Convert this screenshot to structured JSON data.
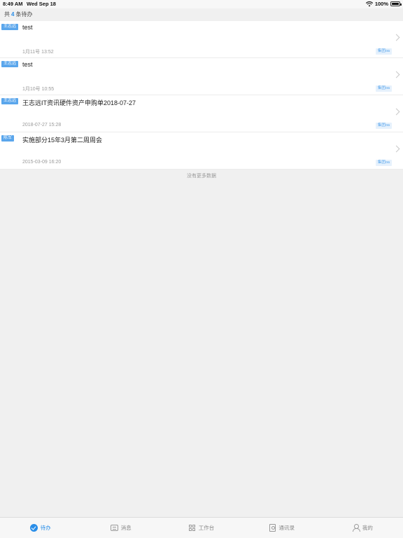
{
  "status_bar": {
    "time": "8:49 AM",
    "date": "Wed Sep 18",
    "battery": "100%",
    "icons": [
      "wifi-icon",
      "battery-icon"
    ]
  },
  "summary": {
    "prefix": "共",
    "count": "4",
    "suffix": "条待办"
  },
  "items": [
    {
      "tag": "王志远",
      "title": "test",
      "time": "1月11号 13:52",
      "source": "集团oa"
    },
    {
      "tag": "王志远",
      "title": "test",
      "time": "1月10号 10:55",
      "source": "集团oa"
    },
    {
      "tag": "王志远",
      "title": "王志远IT资讯硬件资产申购单2018-07-27",
      "time": "2018-07-27 15:28",
      "source": "集团oa"
    },
    {
      "tag": "陈军",
      "title": "实施部分15年3月第二周周会",
      "time": "2015-03-09 16:20",
      "source": "集团oa"
    }
  ],
  "no_more": "没有更多数据",
  "tabs": [
    {
      "label": "待办",
      "icon": "todo-icon",
      "active": true
    },
    {
      "label": "消息",
      "icon": "message-icon",
      "active": false
    },
    {
      "label": "工作台",
      "icon": "workbench-icon",
      "active": false
    },
    {
      "label": "通讯录",
      "icon": "contacts-icon",
      "active": false
    },
    {
      "label": "我的",
      "icon": "profile-icon",
      "active": false
    }
  ],
  "colors": {
    "accent": "#2a8ee8",
    "tag": "#5aa6ec",
    "background": "#f0f0f0"
  }
}
